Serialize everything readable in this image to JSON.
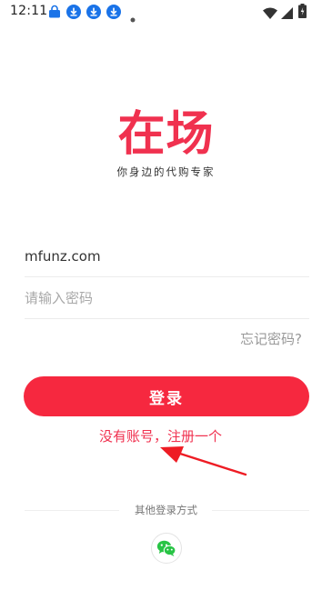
{
  "status_bar": {
    "time": "12:11",
    "icons": [
      "bag-icon",
      "download-icon",
      "download-icon",
      "download-icon",
      "dot-icon",
      "wifi-icon",
      "signal-icon",
      "battery-icon"
    ]
  },
  "logo": {
    "title": "在场",
    "tagline": "你身边的代购专家",
    "brand_color": "#f0314f"
  },
  "form": {
    "username_value": "mfunz.com",
    "password_placeholder": "请输入密码",
    "forgot_label": "忘记密码?",
    "login_label": "登录",
    "login_color": "#f6283f",
    "register_label": "没有账号，注册一个"
  },
  "other_login": {
    "label": "其他登录方式",
    "options": [
      "wechat-icon"
    ],
    "wechat_color": "#28c445"
  }
}
